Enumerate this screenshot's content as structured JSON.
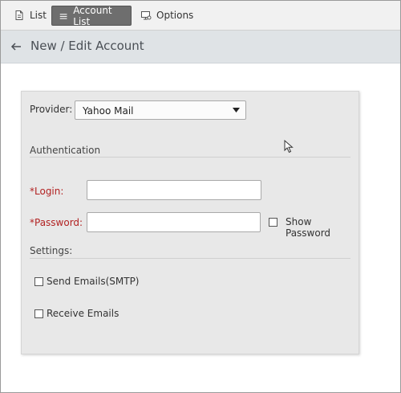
{
  "toolbar": {
    "list_label": "List",
    "account_list_label": "Account List",
    "options_label": "Options"
  },
  "header": {
    "title": "New / Edit Account"
  },
  "form": {
    "provider_label": "Provider:",
    "provider_value": "Yahoo Mail",
    "authentication_heading": "Authentication",
    "login_label": "*Login:",
    "login_value": "",
    "password_label": "*Password:",
    "password_value": "",
    "show_password_label": "Show Password",
    "settings_heading": "Settings:",
    "send_emails_label": "Send Emails(SMTP)",
    "receive_emails_label": "Receive Emails"
  },
  "colors": {
    "required_label": "#b22222",
    "active_tab_bg": "#6e6e6e",
    "header_bg": "#dfe3e6",
    "card_bg": "#e8e8e8"
  },
  "icons": {
    "list": "document-icon",
    "account_list": "list-lines-icon",
    "options": "monitor-settings-icon",
    "back": "arrow-left-icon",
    "dropdown": "triangle-down-icon"
  }
}
